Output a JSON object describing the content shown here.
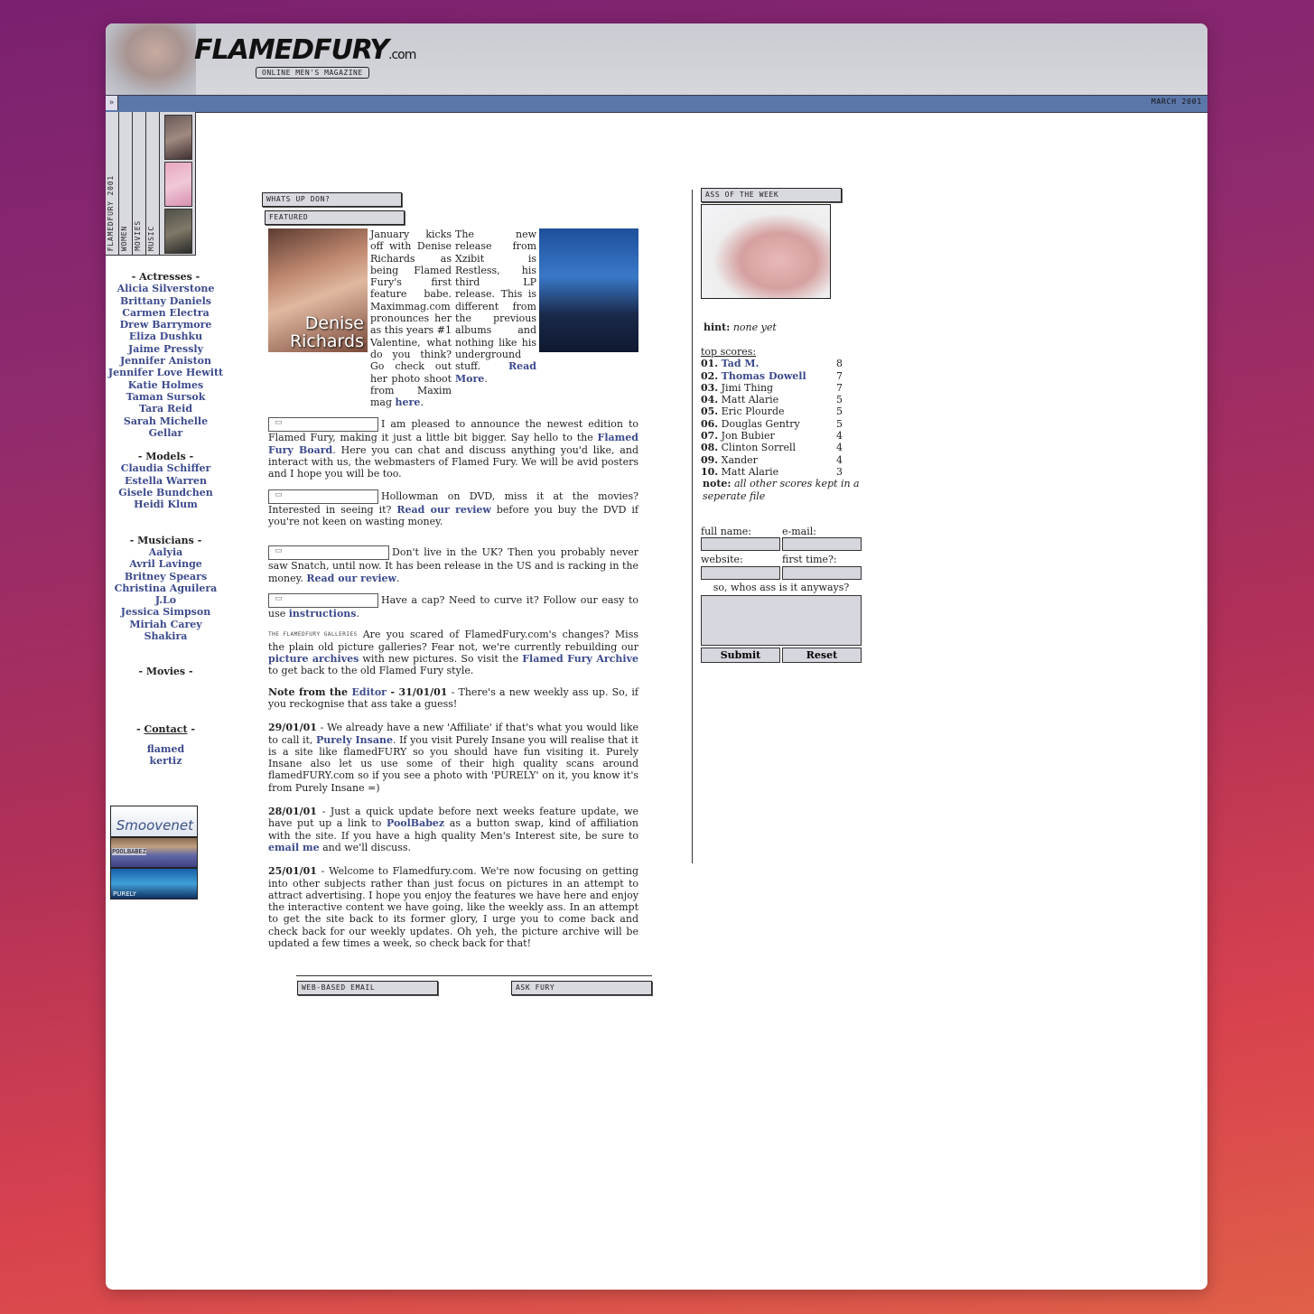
{
  "header": {
    "logo_text": "FLAMEDFURY",
    "logo_suffix": ".com",
    "tagline": "ONLINE MEN'S MAGAZINE",
    "date": "MARCH 2001",
    "collapse_glyph": "»"
  },
  "vnav": {
    "tabs": [
      "FLAMEDFURY 2001",
      "WOMEN",
      "MOVIES",
      "MUSIC"
    ]
  },
  "sidebar": {
    "actresses_heading": "- Actresses -",
    "actresses": [
      "Alicia Silverstone",
      "Brittany Daniels",
      "Carmen Electra",
      "Drew Barrymore",
      "Eliza Dushku",
      "Jaime Pressly",
      "Jennifer Aniston",
      "Jennifer Love Hewitt",
      "Katie Holmes",
      "Taman Sursok",
      "Tara Reid",
      "Sarah Michelle Gellar"
    ],
    "models_heading": "- Models -",
    "models": [
      "Claudia Schiffer",
      "Estella Warren",
      "Gisele Bundchen",
      "Heidi Klum"
    ],
    "musicians_heading": "- Musicians -",
    "musicians": [
      "Aalyia",
      "Avril Lavinge",
      "Britney Spears",
      "Christina Aguilera",
      "J.Lo",
      "Jessica Simpson",
      "Miriah Carey",
      "Shakira"
    ],
    "movies_heading": "- Movies -",
    "contact_prefix": "- ",
    "contact_label": "Contact",
    "contact_suffix": " -",
    "contacts": [
      "flamed",
      "kertiz"
    ],
    "badges": [
      "Smoovenet",
      "POOLBABEZ",
      "PURELY"
    ]
  },
  "main": {
    "whats_up_banner": "WHATS UP DON?",
    "featured_banner": "FEATURED",
    "photo_left_caption_1": "Denise",
    "photo_left_caption_2": "Richards",
    "feature_left": "January kicks off with Denise Richards as being Flamed Fury's first feature babe. Maximmag.com pronounces her as this years #1 Valentine, what do you think? Go check out her photo shoot from Maxim mag ",
    "feature_left_link": "here",
    "feature_right": "The new release from Xzibit is Restless, his third LP release. This is different from the previous albums and nothing like his underground stuff. ",
    "feature_right_link_1": "Read",
    "feature_right_link_2": "More",
    "p1_pre": "I am pleased to announce the newest edition to Flamed Fury, making it just a little bit bigger. Say hello to the ",
    "p1_link": "Flamed Fury Board",
    "p1_post": ". Here you can chat and discuss anything you'd like, and interact with us, the webmasters of Flamed Fury. We will be avid posters and I hope you will be too.",
    "p2_pre": "Hollowman on DVD, miss it at the movies? Interested in seeing it? ",
    "p2_link": "Read our review",
    "p2_post": " before you buy the DVD if you're not keen on wasting money.",
    "p3_pre": "Don't live in the UK? Then you probably never saw Snatch, until now. It has been release in the US and is racking in the money. ",
    "p3_link": "Read our review",
    "p3_post": ".",
    "p4_pre": "Have a cap? Need to curve it? Follow our easy to use ",
    "p4_link": "instructions",
    "p4_post": ".",
    "p5_gallery": "THE FLAMEDFURY GALLERIES",
    "p5_pre": "Are you scared of FlamedFury.com's changes? Miss the plain old picture galleries? Fear not, we're currently rebuilding our ",
    "p5_link1": "picture archives",
    "p5_mid": " with new pictures. So visit the ",
    "p5_link2": "Flamed Fury Archive",
    "p5_post": " to get back to the old Flamed Fury style.",
    "n1_bold": "Note from the ",
    "n1_link": "Editor",
    "n1_date": " - 31/01/01",
    "n1_text": " - There's a new weekly ass up. So, if you reckognise that ass take a guess!",
    "n2_date": "29/01/01",
    "n2_pre": " - We already have a new 'Affiliate' if that's what you would like to call it, ",
    "n2_link": "Purely Insane",
    "n2_post": ". If you visit Purely Insane you will realise that it is a site like flamedFURY so you should have fun visiting it. Purely Insane also let us use some of their high quality scans around flamedFURY.com so if you see a photo with 'PURELY' on it, you know it's from Purely Insane =)",
    "n3_date": "28/01/01",
    "n3_pre": " - Just a quick update before next weeks feature update, we have put up a link to ",
    "n3_link1": "PoolBabez",
    "n3_mid": " as a button swap, kind of affiliation with the site. If you have a high quality Men's Interest site, be sure to ",
    "n3_link2": "email me",
    "n3_post": " and we'll discuss.",
    "n4_date": "25/01/01",
    "n4_text": " - Welcome to Flamedfury.com. We're now focusing on getting into other subjects rather than just focus on pictures in an attempt to attract advertising. I hope you enjoy the features we have here and enjoy the interactive content we have going, like the weekly ass. In an attempt to get the site back to its former glory, I urge you to come back and check back for our weekly updates. Oh yeh, the picture archive will be updated a few times a week, so check back for that!"
  },
  "footer": {
    "email_banner": "WEB-BASED EMAIL",
    "ask_banner": "ASK FURY"
  },
  "ass_of_week": {
    "banner": "ASS OF THE WEEK",
    "hint_label": "hint:",
    "hint_value": "none yet",
    "top_scores_label": "top scores:",
    "scores": [
      {
        "rank": "01.",
        "name": "Tad M.",
        "score": "8",
        "link": true
      },
      {
        "rank": "02.",
        "name": "Thomas Dowell",
        "score": "7",
        "link": true
      },
      {
        "rank": "03.",
        "name": "Jimi Thing",
        "score": "7",
        "link": false
      },
      {
        "rank": "04.",
        "name": "Matt Alarie",
        "score": "5",
        "link": false
      },
      {
        "rank": "05.",
        "name": "Eric Plourde",
        "score": "5",
        "link": false
      },
      {
        "rank": "06.",
        "name": "Douglas Gentry",
        "score": "5",
        "link": false
      },
      {
        "rank": "07.",
        "name": "Jon Bubier",
        "score": "4",
        "link": false
      },
      {
        "rank": "08.",
        "name": "Clinton Sorrell",
        "score": "4",
        "link": false
      },
      {
        "rank": "09.",
        "name": "Xander",
        "score": "4",
        "link": false
      },
      {
        "rank": "10.",
        "name": "Matt Alarie",
        "score": "3",
        "link": false
      }
    ],
    "note_label": "note:",
    "note_text": "all other scores kept in a seperate file",
    "form": {
      "full_name_label": "full name:",
      "email_label": "e-mail:",
      "website_label": "website:",
      "first_time_label": "first time?:",
      "question_label": "so, whos ass is it anyways?",
      "submit_label": "Submit",
      "reset_label": "Reset"
    }
  }
}
